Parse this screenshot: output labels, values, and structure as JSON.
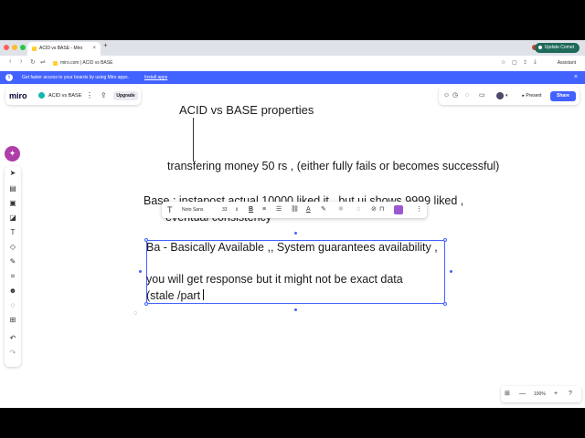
{
  "browser": {
    "tab_title": "ACID vs BASE - Miro",
    "tab_close": "×",
    "new_tab": "+",
    "update_label": "Update Comet",
    "url": "miro.com | ACID vs BASE",
    "assistant_label": "Assistant"
  },
  "banner": {
    "info_icon": "i",
    "message": "Get faster access to your boards by using Miro apps.",
    "link": "Install apps",
    "close": "×"
  },
  "header": {
    "logo": "miro",
    "board_name": "ACID vs BASE",
    "menu": "⋮",
    "share_icon": "⇪",
    "upgrade": "Upgrade",
    "present": "▸ Present",
    "share": "Share"
  },
  "board": {
    "title": "ACID vs BASE properties",
    "transfer_note": "transfering money 50 rs , (either fully fails or becomes successful)",
    "base_note_line1": "Base : instapost actual 10000 liked it , but ui shows 9999 liked ,",
    "base_note_line2": "eventual consistency",
    "edit_line1": "Ba - Basically Available ,, System guarantees availability ,",
    "edit_line2": "you will get response but it might not be exact data",
    "edit_line3": "(stale /part"
  },
  "format_toolbar": {
    "font": "Noto Sans",
    "size": "33"
  },
  "zoom": {
    "value": "100%",
    "minus": "—",
    "plus": "+",
    "help": "?"
  },
  "colors": {
    "accent": "#4262ff",
    "ai": "#b03ea8",
    "update": "#1f6a5a"
  }
}
